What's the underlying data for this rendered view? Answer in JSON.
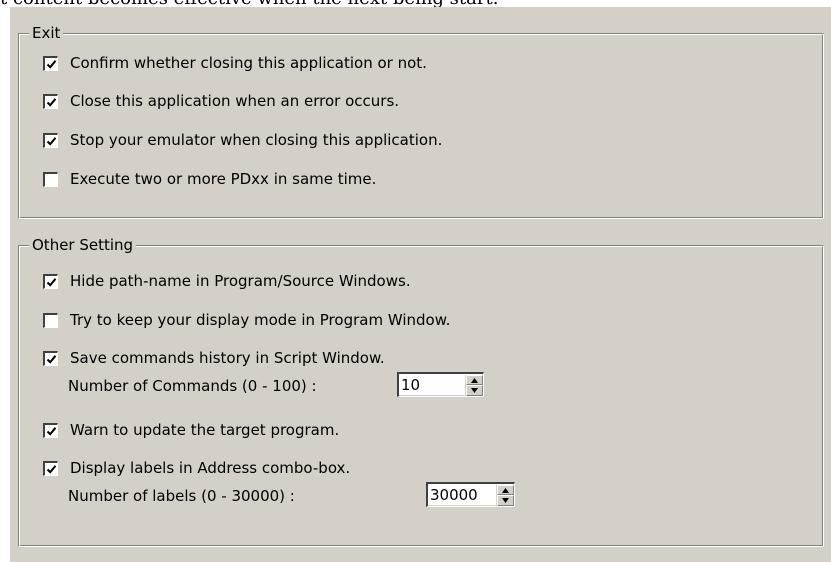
{
  "top_note": "t content becomes effective when the next being start.",
  "exit_group": {
    "title": "Exit",
    "items": [
      {
        "label": "Confirm whether closing this application or not.",
        "checked": true
      },
      {
        "label": "Close this application when an error occurs.",
        "checked": true
      },
      {
        "label": "Stop your emulator when closing this application.",
        "checked": true
      },
      {
        "label": "Execute two or more PDxx in same time.",
        "checked": false
      }
    ]
  },
  "other_group": {
    "title": "Other Setting",
    "items": [
      {
        "label": "Hide path-name in Program/Source Windows.",
        "checked": true
      },
      {
        "label": "Try to keep your display mode in Program Window.",
        "checked": false
      },
      {
        "label": "Save commands history in Script Window.",
        "checked": true
      },
      {
        "label": "Warn to update the target program.",
        "checked": true
      },
      {
        "label": "Display labels in Address combo-box.",
        "checked": true
      }
    ],
    "commands_label": "Number of Commands (0 - 100) :",
    "commands_value": "10",
    "labels_label": "Number of labels (0 - 30000) :",
    "labels_value": "30000"
  },
  "icons": {
    "checked": "checkmark-icon",
    "spin_up": "arrow-up-icon",
    "spin_down": "arrow-down-icon"
  },
  "colors": {
    "dialog_background": "#d4d0c8",
    "checkbox_background": "#ffffff"
  }
}
